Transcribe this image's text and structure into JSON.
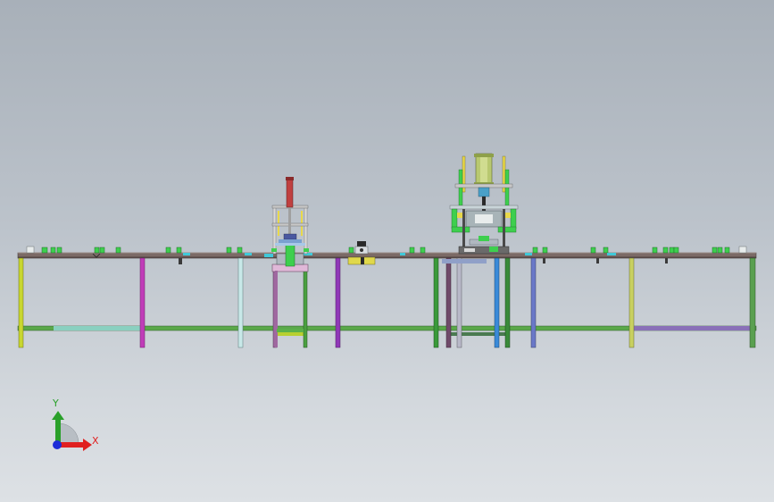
{
  "view": {
    "background_top": "#a8b0b9",
    "background_bottom": "#dde1e5"
  },
  "triad": {
    "x_label": "X",
    "y_label": "Y",
    "x_color": "#e02020",
    "y_color": "#2aa02a",
    "z_color": "#1c2cd8"
  },
  "model": {
    "name": "assembly-line",
    "left-press-station": "press",
    "right-press-station": "press",
    "frame_color": "#7a8a3a",
    "table_top_color": "#6e5e5e",
    "part_color": "#3ecf4e"
  }
}
